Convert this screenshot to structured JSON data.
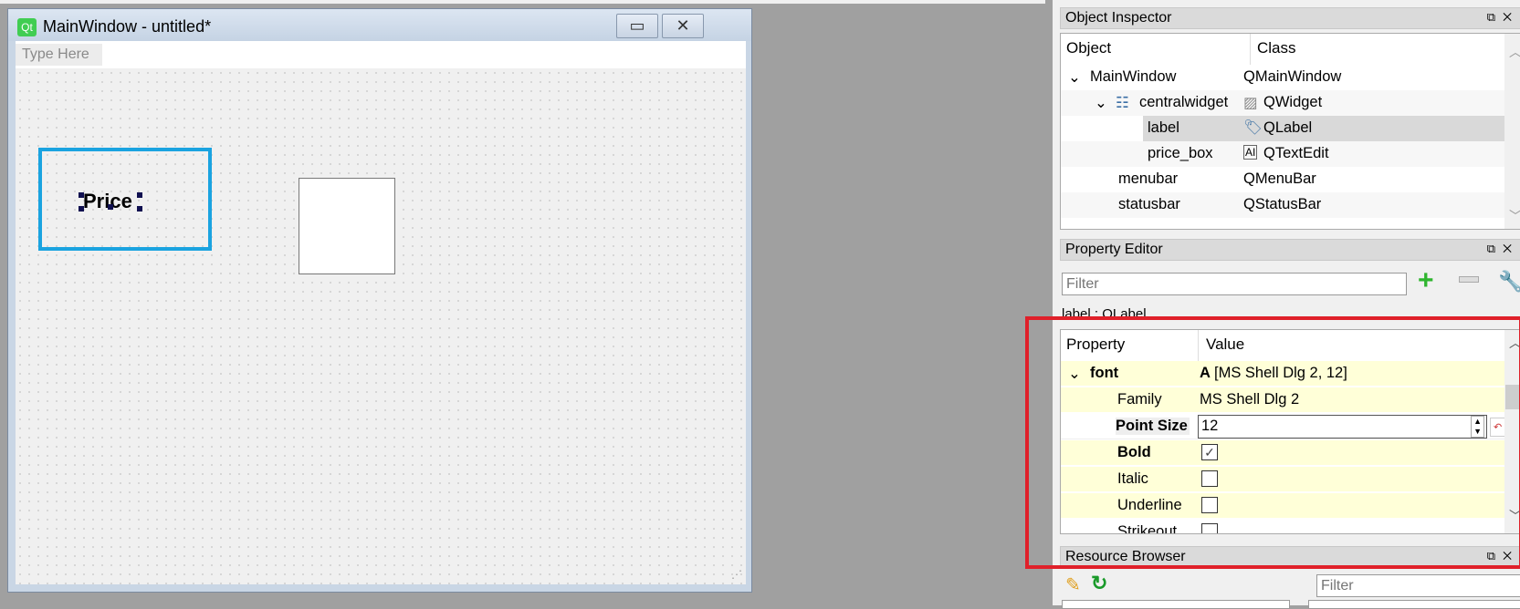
{
  "designer_window": {
    "title": "MainWindow - untitled*",
    "app_icon": "Qt",
    "minimize_icon": "minimize-icon",
    "close_icon": "close-icon",
    "menubar_placeholder": "Type Here",
    "label_text": "Price"
  },
  "object_inspector": {
    "title": "Object Inspector",
    "columns": [
      "Object",
      "Class"
    ],
    "rows": [
      {
        "object": "MainWindow",
        "class": "QMainWindow",
        "expanded": true
      },
      {
        "object": "centralwidget",
        "class": "QWidget",
        "expanded": true
      },
      {
        "object": "label",
        "class": "QLabel",
        "selected": true
      },
      {
        "object": "price_box",
        "class": "QTextEdit"
      },
      {
        "object": "menubar",
        "class": "QMenuBar"
      },
      {
        "object": "statusbar",
        "class": "QStatusBar"
      }
    ]
  },
  "property_editor": {
    "title": "Property Editor",
    "filter_placeholder": "Filter",
    "object_label": "label : QLabel",
    "columns": [
      "Property",
      "Value"
    ],
    "rows": [
      {
        "property": "font",
        "value": "[MS Shell Dlg 2, 12]"
      },
      {
        "property": "Family",
        "value": "MS Shell Dlg 2"
      },
      {
        "property": "Point Size",
        "value": "12"
      },
      {
        "property": "Bold",
        "checked": true
      },
      {
        "property": "Italic",
        "checked": false
      },
      {
        "property": "Underline",
        "checked": false
      },
      {
        "property": "Strikeout",
        "checked": false
      }
    ]
  },
  "resource_browser": {
    "title": "Resource Browser",
    "filter_placeholder": "Filter"
  },
  "colors": {
    "selection": "#1aa3e0",
    "highlight_box": "#e0202a",
    "property_row": "#ffffd8"
  }
}
